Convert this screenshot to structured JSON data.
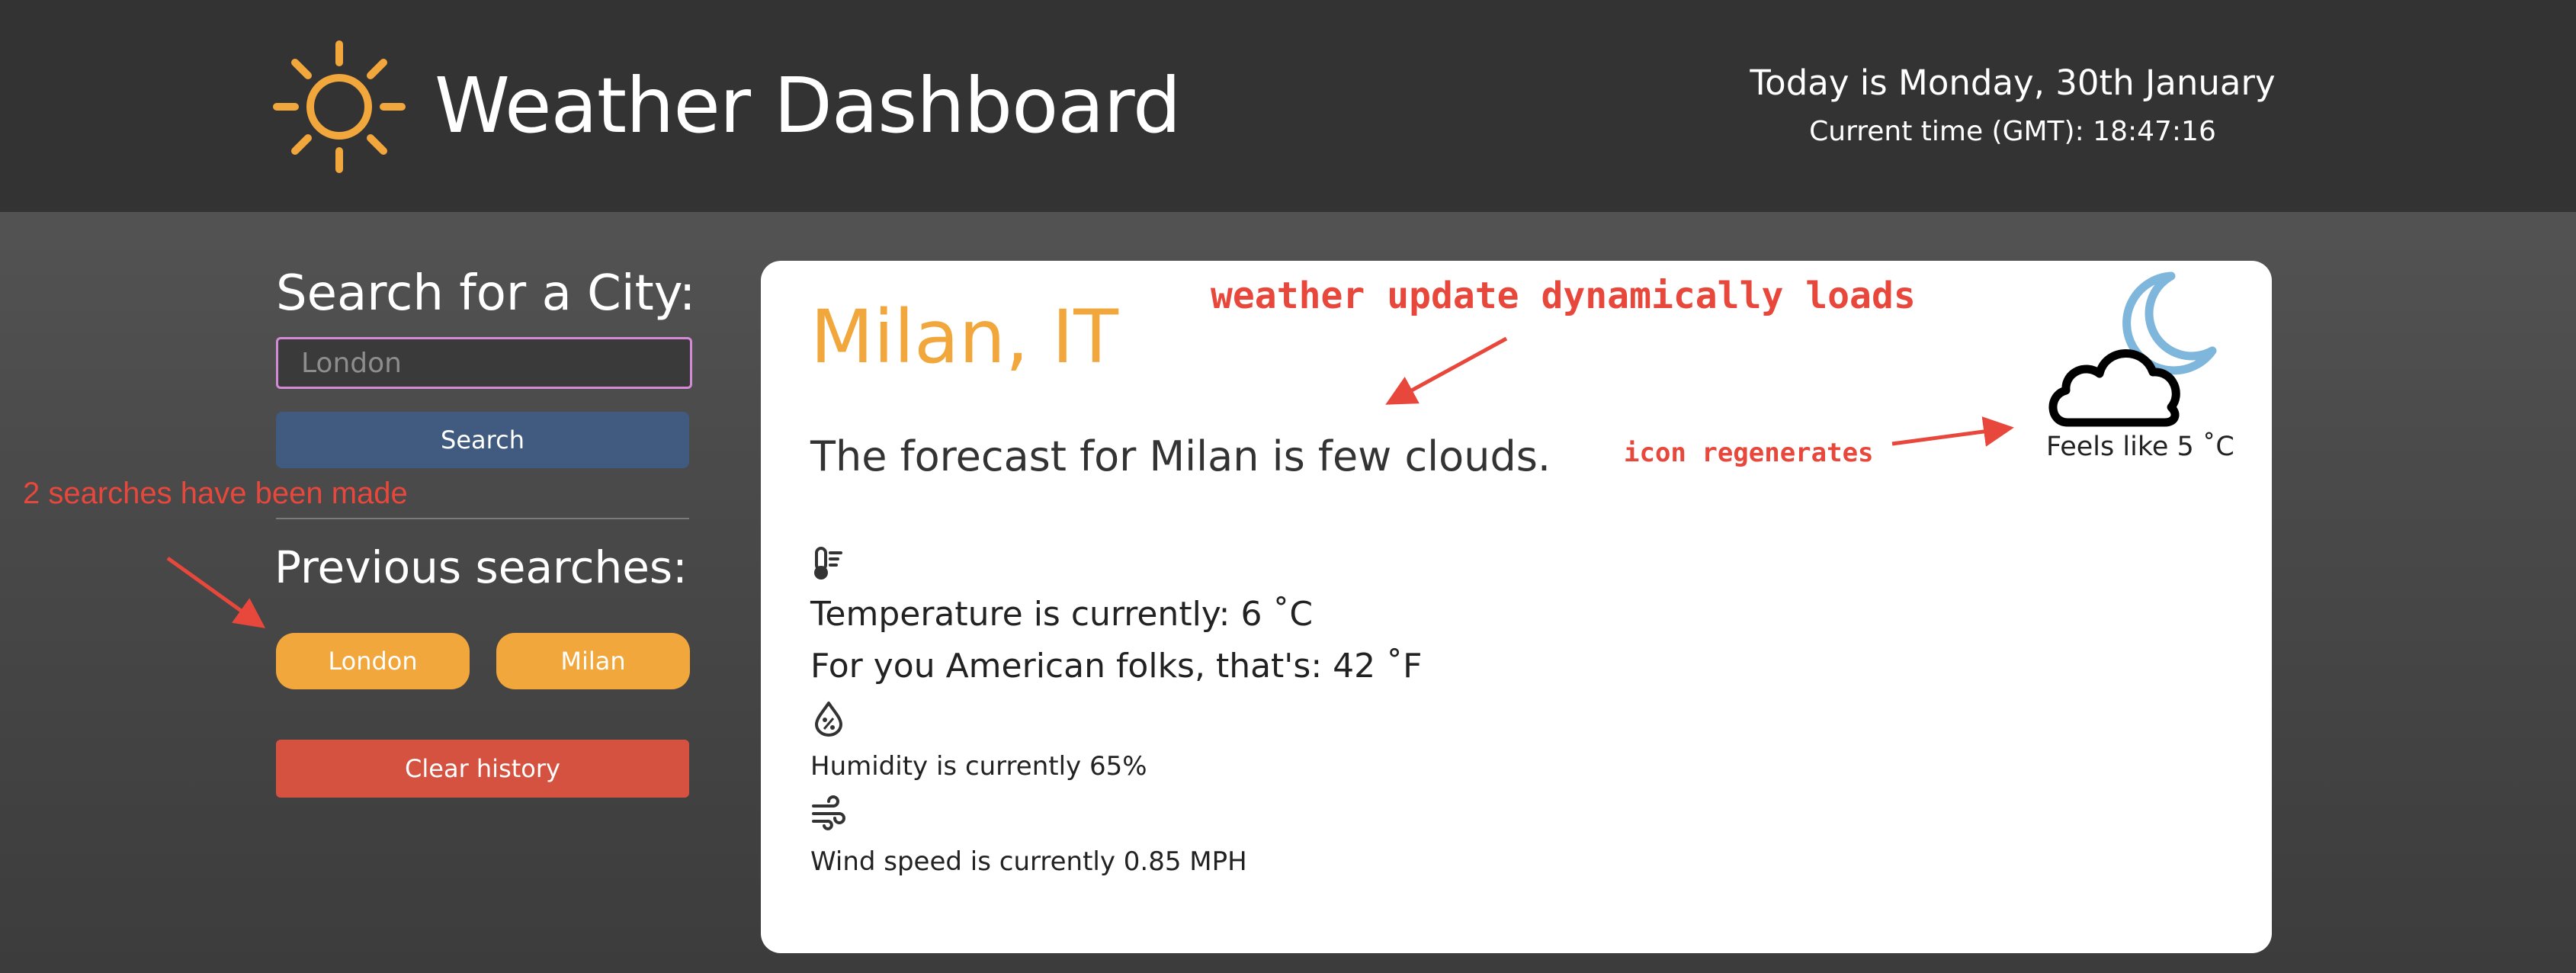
{
  "header": {
    "title": "Weather Dashboard",
    "date_text": "Today is Monday, 30th January",
    "time_text": "Current time (GMT): 18:47:16",
    "logo_icon": "sun-icon",
    "logo_color": "#f1a73b"
  },
  "sidebar": {
    "search_heading": "Search for a City:",
    "search_placeholder": "London",
    "search_button": "Search",
    "previous_heading": "Previous searches:",
    "history": [
      "London",
      "Milan"
    ],
    "clear_button": "Clear history"
  },
  "weather": {
    "city": "Milan, IT",
    "forecast": "The forecast for Milan is few clouds.",
    "condition_icon": "cloudy-night-icon",
    "feels_like": "Feels like 5 ˚C",
    "temperature_icon": "thermometer-icon",
    "temperature": "Temperature is currently: 6 ˚C",
    "fahrenheit": "For you American folks, that's: 42 ˚F",
    "humidity_icon": "humidity-drop-icon",
    "humidity": "Humidity is currently 65%",
    "wind_icon": "wind-icon",
    "wind": "Wind speed is currently 0.85 MPH"
  },
  "annotations": {
    "dynamic_load": "weather update dynamically loads",
    "icon_regen": "icon regenerates",
    "searches_made": "2 searches have been made"
  },
  "colors": {
    "header_bg": "#333333",
    "accent_orange": "#f1a73b",
    "search_button": "#405a80",
    "clear_button": "#d4523f",
    "annotation_red": "#e8473c",
    "input_border": "#d58ad7"
  }
}
